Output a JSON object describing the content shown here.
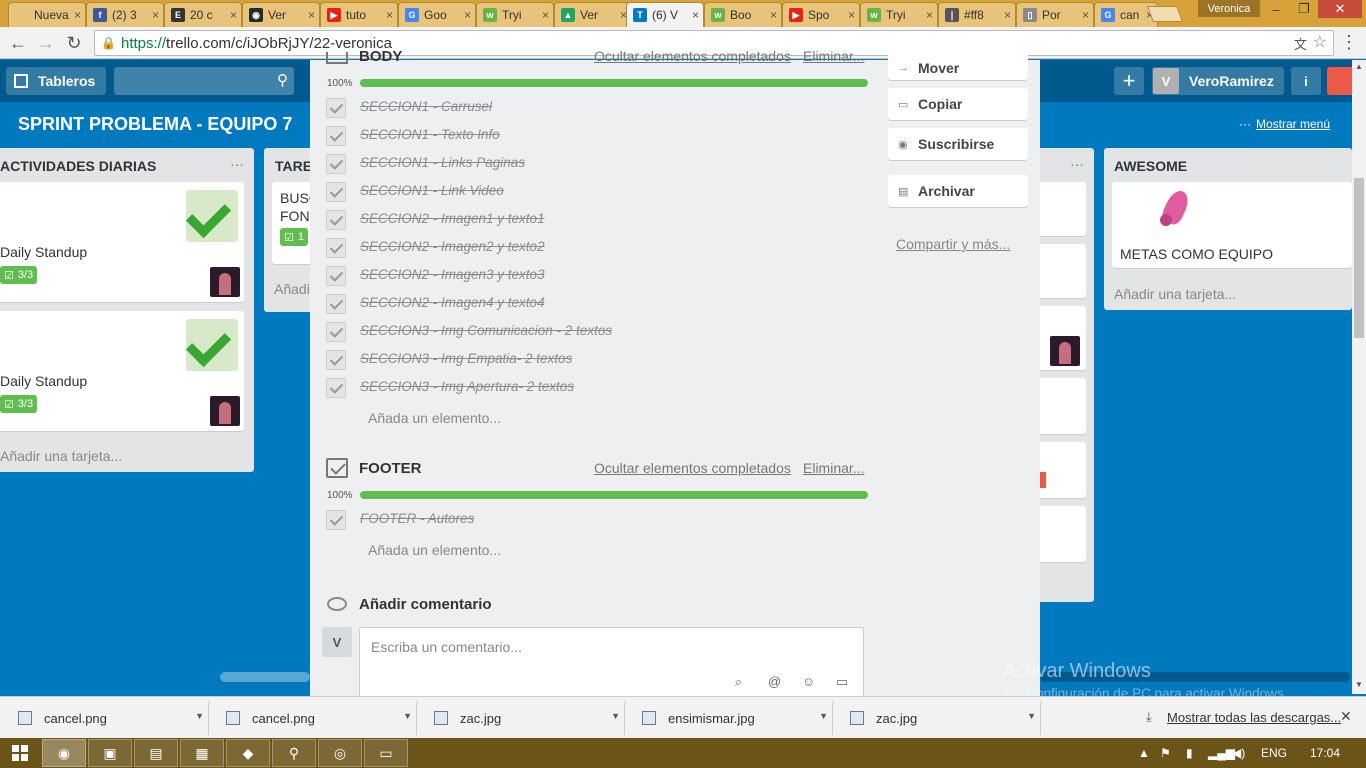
{
  "browser": {
    "tabs": [
      {
        "label": "Nueva p",
        "color": "#e8c37a",
        "fav": "",
        "icon": "page-icon"
      },
      {
        "label": "(2) 3",
        "color": "#3b5998",
        "fav": "f",
        "icon": "facebook-icon"
      },
      {
        "label": "20 c",
        "color": "#333333",
        "fav": "E",
        "icon": "e-icon"
      },
      {
        "label": "Ver",
        "color": "#24292e",
        "fav": "◉",
        "icon": "github-icon"
      },
      {
        "label": "tuto",
        "color": "#e62117",
        "fav": "▶",
        "icon": "youtube-icon"
      },
      {
        "label": "Goo",
        "color": "#4285f4",
        "fav": "G",
        "icon": "google-icon"
      },
      {
        "label": "Tryi",
        "color": "#6ab344",
        "fav": "w",
        "icon": "tryit-icon"
      },
      {
        "label": "Ver",
        "color": "#1fa463",
        "fav": "▲",
        "icon": "drive-icon"
      },
      {
        "label": "(6) V",
        "color": "#0079bf",
        "fav": "T",
        "icon": "trello-icon"
      },
      {
        "label": "Boo",
        "color": "#6ab344",
        "fav": "w",
        "icon": "bootstrap-icon"
      },
      {
        "label": "Spo",
        "color": "#e62117",
        "fav": "▶",
        "icon": "youtube-icon"
      },
      {
        "label": "Tryi",
        "color": "#6ab344",
        "fav": "w",
        "icon": "tryit-icon"
      },
      {
        "label": "#ff8",
        "color": "#555555",
        "fav": "❘",
        "icon": "color-icon"
      },
      {
        "label": "Por",
        "color": "#888888",
        "fav": "▯",
        "icon": "doc-icon"
      },
      {
        "label": "can",
        "color": "#4285f4",
        "fav": "G",
        "icon": "google-icon"
      }
    ],
    "active_tab": 8,
    "window_user": "Veronica",
    "url_proto": "https://",
    "url_rest": "trello.com/c/iJObRjJY/22-veronica"
  },
  "trello": {
    "boards_label": "Tableros",
    "member_initial": "V",
    "member_name": "VeroRamirez",
    "board_title": "SPRINT PROBLEMA - EQUIPO 7",
    "show_menu": "Mostrar menú",
    "lists": {
      "daily": {
        "title": "ACTIVIDADES DIARIAS",
        "card1_title": "Daily Standup",
        "card1_badge": "3/3",
        "card2_title": "Daily Standup",
        "card2_badge": "3/3",
        "add_card": "Añadir una tarjeta..."
      },
      "tareas": {
        "title": "TARE",
        "card_line1": "BUSC",
        "card_line2": "FONE",
        "card_badge": "1",
        "add_card": "Añadi"
      },
      "awesome": {
        "title": "AWESOME",
        "card_title": "METAS COMO EQUIPO",
        "add_card": "Añadir una tarjeta..."
      }
    }
  },
  "modal": {
    "body_checklist": {
      "title": "BODY",
      "hide_completed": "Ocultar elementos completados",
      "delete": "Eliminar...",
      "percent_label": "100%",
      "progress": 1.0,
      "items": [
        "SECCION1 - Carrusel",
        "SECCION1 - Texto Info",
        "SECCION1 - Links Paginas",
        "SECCION1 - Link Video",
        "SECCION2 - Imagen1 y texto1",
        "SECCION2 - Imagen2 y texto2",
        "SECCION2 - Imagen3 y texto3",
        "SECCION2 - Imagen4 y texto4",
        "SECCION3 - Img Comunicacion - 2 textos",
        "SECCION3 - Img Empatia- 2 textos",
        "SECCION3 - Img Apertura- 2 textos"
      ],
      "add_item": "Añada un elemento..."
    },
    "footer_checklist": {
      "title": "FOOTER",
      "hide_completed": "Ocultar elementos completados",
      "delete": "Eliminar...",
      "percent_label": "100%",
      "progress": 1.0,
      "items": [
        "FOOTER - Autores"
      ],
      "add_item": "Añada un elemento..."
    },
    "comment": {
      "title": "Añadir comentario",
      "avatar": "V",
      "placeholder": "Escriba un comentario..."
    },
    "sidebar": {
      "move": "Mover",
      "copy": "Copiar",
      "subscribe": "Suscribirse",
      "archive": "Archivar",
      "share": "Compartir y más..."
    }
  },
  "watermark": {
    "title": "Activar Windows",
    "subtitle": "Ir a Configuración de PC para activar Windows."
  },
  "downloads": {
    "items": [
      "cancel.png",
      "cancel.png",
      "zac.jpg",
      "ensimismar.jpg",
      "zac.jpg"
    ],
    "show_all": "Mostrar todas las descargas..."
  },
  "taskbar": {
    "language": "ENG",
    "time": "17:04"
  }
}
